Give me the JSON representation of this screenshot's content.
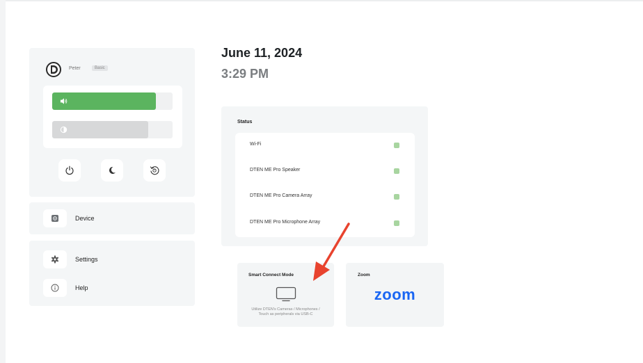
{
  "profile": {
    "name": "Peter",
    "badge": "Basic",
    "volume_level": 0.86,
    "brightness_level": 0.8
  },
  "menu": {
    "device_label": "Device",
    "settings_label": "Settings",
    "help_label": "Help"
  },
  "clock": {
    "date": "June 11, 2024",
    "time": "3:29 PM"
  },
  "status": {
    "title": "Status",
    "items": [
      {
        "label": "Wi-Fi"
      },
      {
        "label": "DTEN ME Pro Speaker"
      },
      {
        "label": "DTEN ME Pro Camera Array"
      },
      {
        "label": "DTEN ME Pro Microphone Array"
      }
    ],
    "ok_color": "#a8d5a0"
  },
  "cards": {
    "smart_connect": {
      "title": "Smart Connect Mode",
      "desc_line1": "Utilize DTEN's Cameras / Microphones /",
      "desc_line2": "Touch as peripherals via USB-C"
    },
    "zoom": {
      "title": "Zoom",
      "logo_text": "zoom"
    }
  },
  "colors": {
    "volume_fill": "#5bb45f",
    "zoom_brand": "#1a66f3",
    "annotation_arrow": "#e8432e"
  }
}
